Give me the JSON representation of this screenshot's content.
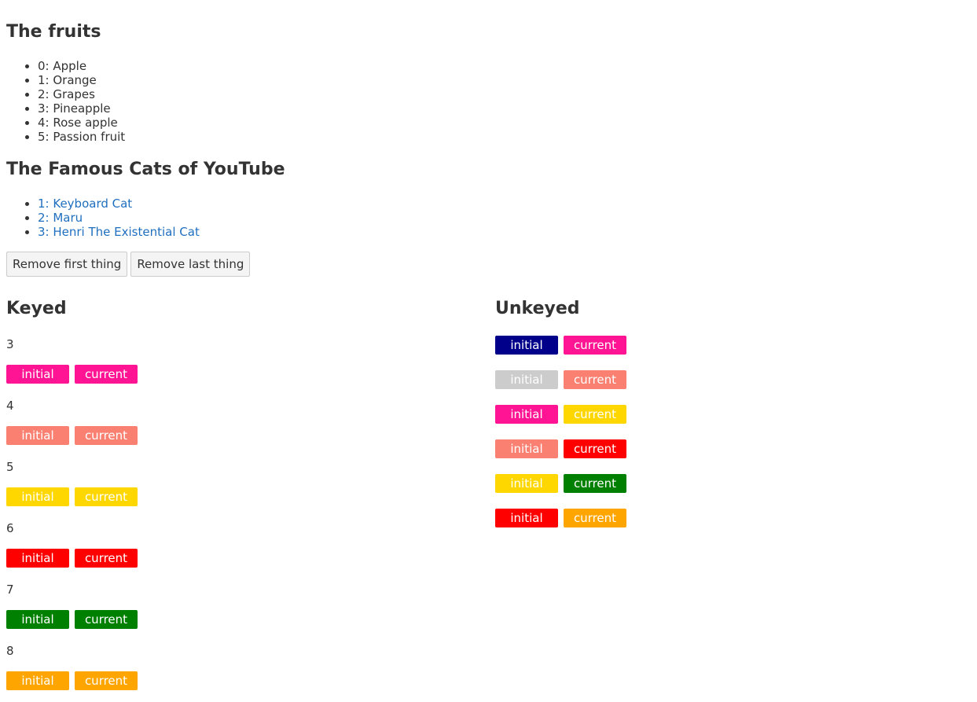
{
  "fruits": {
    "title": "The fruits",
    "items": [
      "0: Apple",
      "1: Orange",
      "2: Grapes",
      "3: Pineapple",
      "4: Rose apple",
      "5: Passion fruit"
    ]
  },
  "cats": {
    "title": "The Famous Cats of YouTube",
    "items": [
      "1: Keyboard Cat",
      "2: Maru",
      "3: Henri The Existential Cat"
    ]
  },
  "buttons": {
    "remove_first": "Remove first thing",
    "remove_last": "Remove last thing"
  },
  "keyed": {
    "title": "Keyed",
    "items": [
      {
        "id": "3",
        "initial_label": "initial",
        "current_label": "current",
        "initial_color": "#ff1493",
        "current_color": "#ff1493"
      },
      {
        "id": "4",
        "initial_label": "initial",
        "current_label": "current",
        "initial_color": "#fa8072",
        "current_color": "#fa8072"
      },
      {
        "id": "5",
        "initial_label": "initial",
        "current_label": "current",
        "initial_color": "#ffd700",
        "current_color": "#ffd700"
      },
      {
        "id": "6",
        "initial_label": "initial",
        "current_label": "current",
        "initial_color": "#ff0000",
        "current_color": "#ff0000"
      },
      {
        "id": "7",
        "initial_label": "initial",
        "current_label": "current",
        "initial_color": "#008000",
        "current_color": "#008000"
      },
      {
        "id": "8",
        "initial_label": "initial",
        "current_label": "current",
        "initial_color": "#ffa500",
        "current_color": "#ffa500"
      }
    ]
  },
  "unkeyed": {
    "title": "Unkeyed",
    "items": [
      {
        "initial_label": "initial",
        "current_label": "current",
        "initial_color": "#00008b",
        "current_color": "#ff1493"
      },
      {
        "initial_label": "initial",
        "current_label": "current",
        "initial_color": "#cccccc",
        "current_color": "#fa8072"
      },
      {
        "initial_label": "initial",
        "current_label": "current",
        "initial_color": "#ff1493",
        "current_color": "#ffd700"
      },
      {
        "initial_label": "initial",
        "current_label": "current",
        "initial_color": "#fa8072",
        "current_color": "#ff0000"
      },
      {
        "initial_label": "initial",
        "current_label": "current",
        "initial_color": "#ffd700",
        "current_color": "#008000"
      },
      {
        "initial_label": "initial",
        "current_label": "current",
        "initial_color": "#ff0000",
        "current_color": "#ffa500"
      }
    ]
  }
}
